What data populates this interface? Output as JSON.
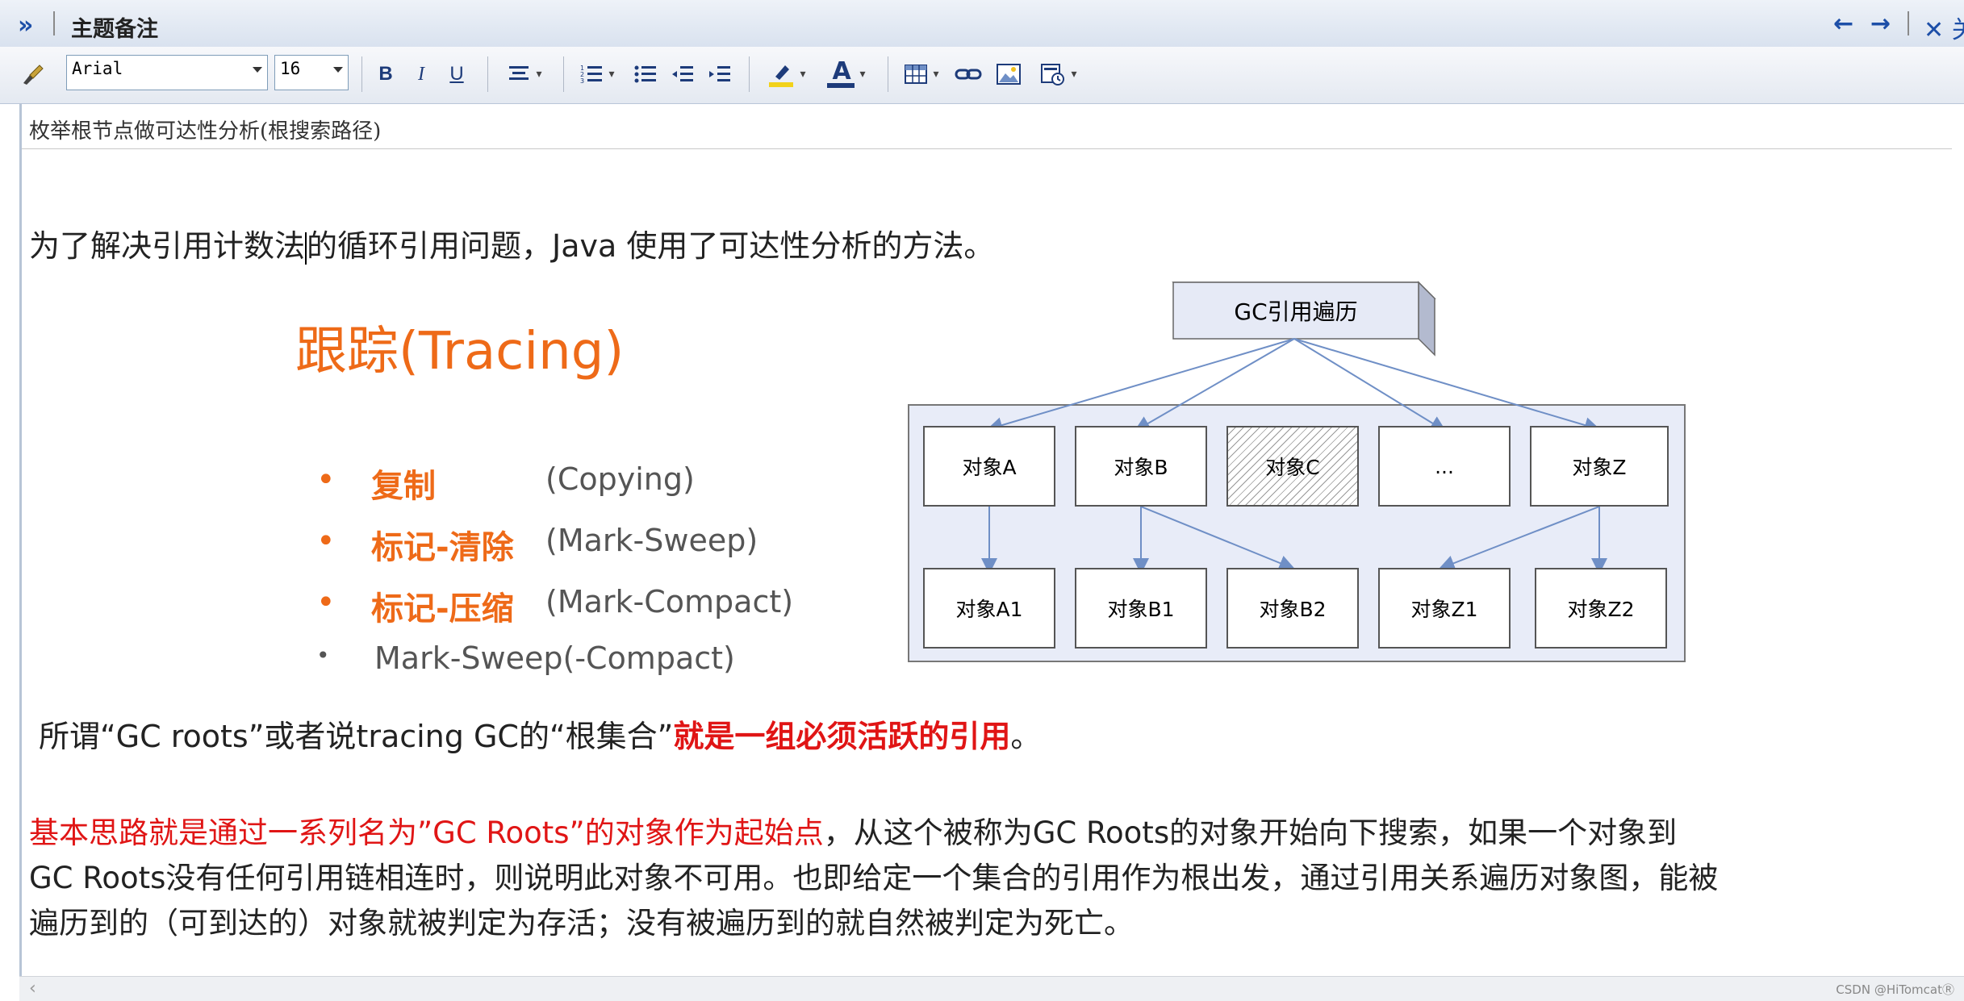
{
  "titlebar": {
    "collapse_icon": "double-chevron-right-icon",
    "title": "主题备注",
    "close_label": "关"
  },
  "toolbar": {
    "font_name": "Arial",
    "font_size": "16",
    "bold": "B",
    "italic": "I",
    "underline": "U",
    "font_color_glyph": "A"
  },
  "subject": "枚举根节点做可达性分析(根搜索路径)",
  "body": {
    "intro_part1": "为了解决引用计数法",
    "intro_part2": "的循环引用问题，Java 使用了可达性分析的方法。",
    "tracing_title": "跟踪(Tracing)",
    "bullets": [
      {
        "marker": "•",
        "title": "复制",
        "paren": "(Copying)"
      },
      {
        "marker": "•",
        "title": "标记-清除",
        "paren": "(Mark-Sweep)"
      },
      {
        "marker": "•",
        "title": "标记-压缩",
        "paren": "(Mark-Compact)"
      },
      {
        "marker": "•",
        "plain": "Mark-Sweep(-Compact)"
      }
    ],
    "gc_line_prefix": "所谓“GC roots”或者说tracing GC的“根集合”",
    "gc_line_emph": "就是一组必须活跃的引用",
    "gc_line_suffix": "。",
    "para_line1_red": "基本思路就是通过一系列名为”GC Roots”的对象作为起始点",
    "para_line1_rest": "，从这个被称为GC Roots的对象开始向下搜索，如果一个对象到",
    "para_line2": "GC Roots没有任何引用链相连时，则说明此对象不可用。也即给定一个集合的引用作为根出发，通过引用关系遍历对象图，能被",
    "para_line3": "遍历到的（可到达的）对象就被判定为存活；没有被遍历到的就自然被判定为死亡。"
  },
  "diagram": {
    "root": "GC引用遍历",
    "level1": [
      "对象A",
      "对象B",
      "对象C",
      "...",
      "对象Z"
    ],
    "level2": [
      "对象A1",
      "对象B1",
      "对象B2",
      "对象Z1",
      "对象Z2"
    ],
    "colors": {
      "panel": "#e8ecf8",
      "arrow": "#6f8fc6",
      "root_fill": "#e6eaf6"
    }
  },
  "footer": {
    "watermark": "CSDN @HiTomcatⓇ"
  }
}
